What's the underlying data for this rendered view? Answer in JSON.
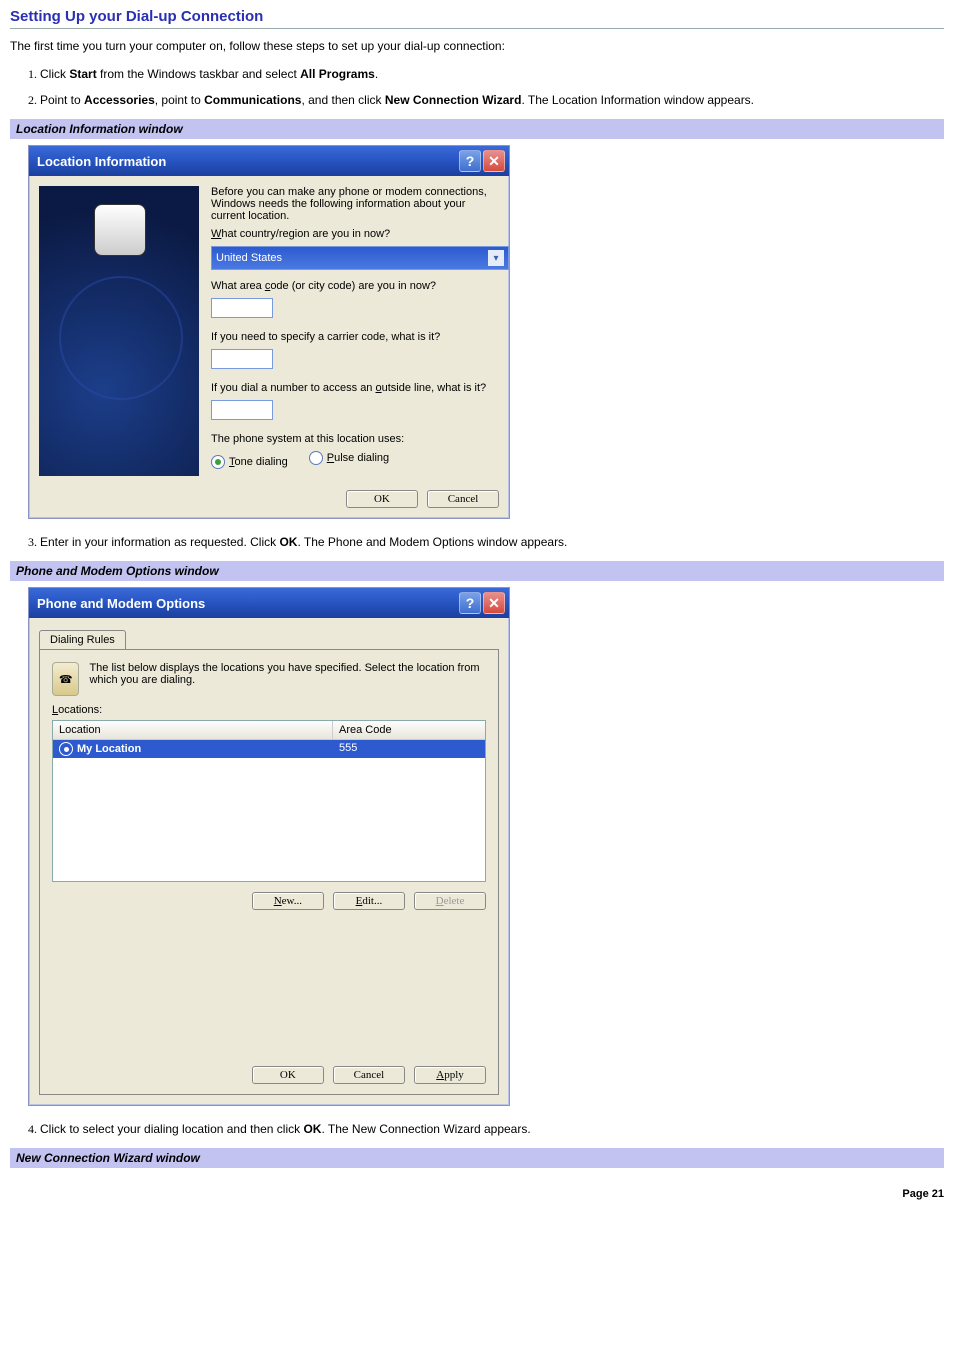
{
  "page": {
    "title": "Setting Up your Dial-up Connection",
    "intro": "The first time you turn your computer on, follow these steps to set up your dial-up connection:",
    "footer": "Page 21"
  },
  "steps": {
    "s1_a": "Click ",
    "s1_b": "Start",
    "s1_c": " from the Windows taskbar and select ",
    "s1_d": "All Programs",
    "s1_e": ".",
    "s2_a": "Point to ",
    "s2_b": "Accessories",
    "s2_c": ", point to ",
    "s2_d": "Communications",
    "s2_e": ", and then click ",
    "s2_f": "New Connection Wizard",
    "s2_g": ". The Location Information window appears.",
    "s3_a": "Enter in your information as requested. Click ",
    "s3_b": "OK",
    "s3_c": ". The Phone and Modem Options window appears.",
    "s4_a": "Click to select your dialing location and then click ",
    "s4_b": "OK",
    "s4_c": ". The New Connection Wizard appears."
  },
  "captions": {
    "c1": "Location Information window",
    "c2": "Phone and Modem Options window",
    "c3": "New Connection Wizard window"
  },
  "dlg1": {
    "title": "Location Information",
    "help": "?",
    "close": "✕",
    "p1": "Before you can make any phone or modem connections, Windows needs the following information about your current location.",
    "q1_pre": "W",
    "q1_rest": "hat country/region are you in now?",
    "select_value": "United States",
    "q2_a": "What area ",
    "q2_u": "c",
    "q2_b": "ode (or city code) are you in now?",
    "q3": "If you need to specify a carrier code, what is it?",
    "q4_a": "If you dial a number to access an ",
    "q4_u": "o",
    "q4_b": "utside line, what is it?",
    "q5": "The phone system at this location uses:",
    "r1_u": "T",
    "r1": "one dialing",
    "r2_u": "P",
    "r2": "ulse dialing",
    "ok": "OK",
    "cancel": "Cancel"
  },
  "dlg2": {
    "title": "Phone and Modem Options",
    "tab": "Dialing Rules",
    "desc": "The list below displays the locations you have specified. Select the location from which you are dialing.",
    "loc_label_u": "L",
    "loc_label": "ocations:",
    "col1": "Location",
    "col2": "Area Code",
    "row_name": "My Location",
    "row_code": "555",
    "btn_new_u": "N",
    "btn_new": "ew...",
    "btn_edit_u": "E",
    "btn_edit": "dit...",
    "btn_delete_u": "D",
    "btn_delete": "elete",
    "ok": "OK",
    "cancel": "Cancel",
    "apply_u": "A",
    "apply": "pply"
  }
}
